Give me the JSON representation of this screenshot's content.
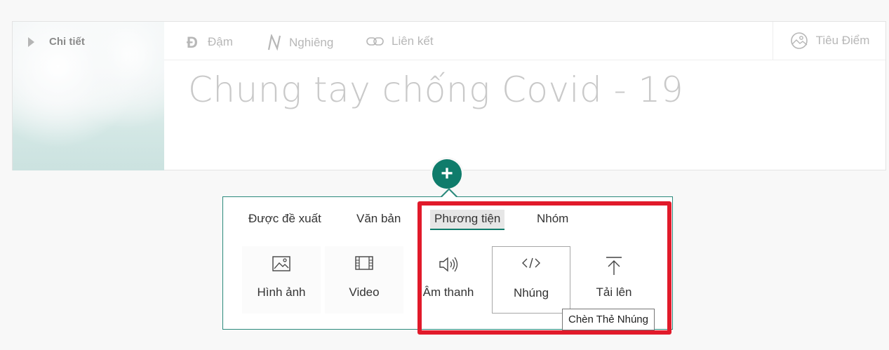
{
  "header": {
    "detail_label": "Chi tiết",
    "tools": {
      "bold": "Đậm",
      "italic": "Nghiêng",
      "link": "Liên kết",
      "focus": "Tiêu Điểm"
    },
    "icons": {
      "bold": "bold-icon",
      "italic": "italic-icon",
      "link": "link-icon",
      "focus": "focus-icon"
    },
    "title": "Chung tay chống Covid - 19"
  },
  "add_button": {
    "label": "+",
    "icon": "plus-icon"
  },
  "toolbox": {
    "tabs": [
      {
        "label": "Được đề xuất"
      },
      {
        "label": "Văn bản"
      },
      {
        "label": "Phương tiện",
        "active": true
      },
      {
        "label": "Nhóm"
      }
    ],
    "items": [
      {
        "label": "Hình ảnh",
        "icon": "image-icon"
      },
      {
        "label": "Video",
        "icon": "film-icon"
      },
      {
        "label": "Âm thanh",
        "icon": "speaker-icon"
      },
      {
        "label": "Nhúng",
        "icon": "code-icon",
        "selected": true
      },
      {
        "label": "Tải lên",
        "icon": "upload-icon"
      }
    ],
    "tooltip": "Chèn Thẻ Nhúng"
  },
  "colors": {
    "accent": "#0f7c6b",
    "highlight": "#e11a2a"
  }
}
